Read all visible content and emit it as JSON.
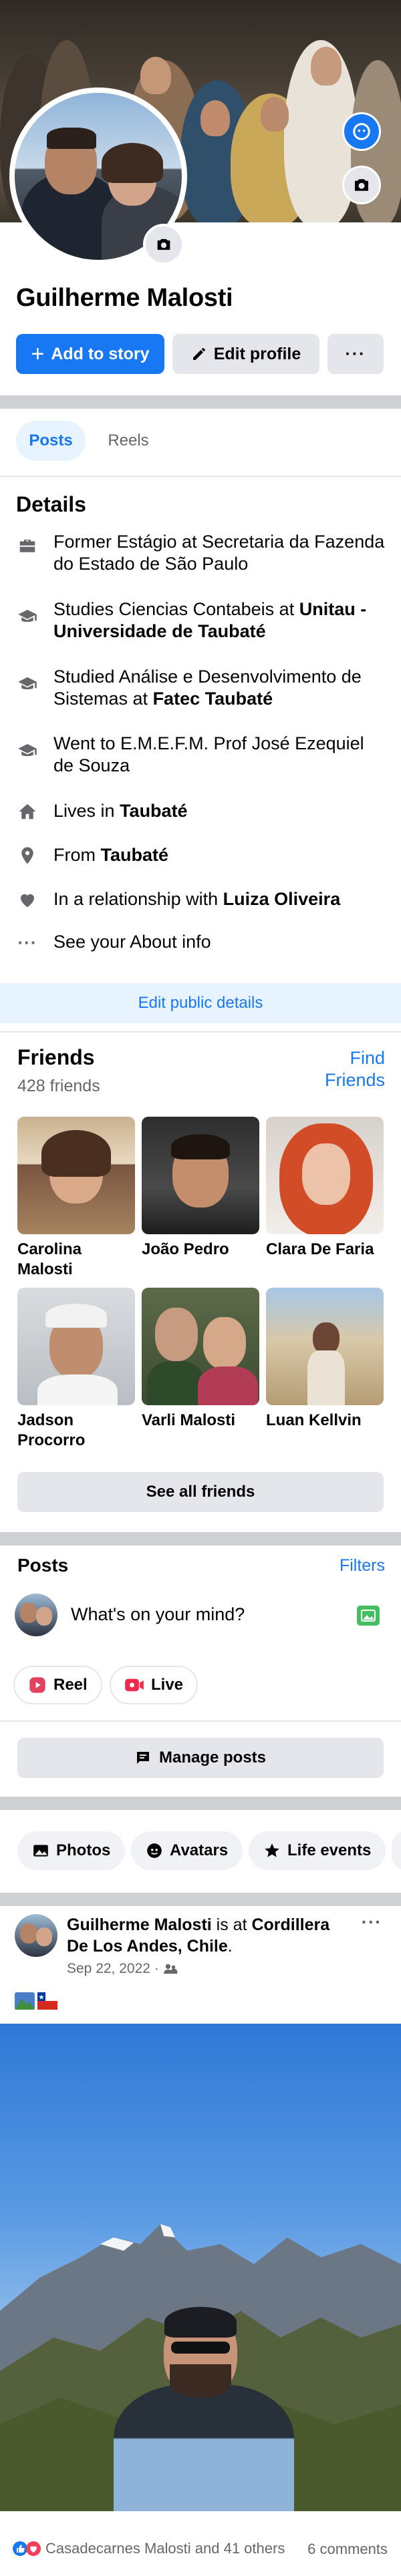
{
  "profile": {
    "name": "Guilherme Malosti",
    "add_to_story": "Add to story",
    "edit_profile": "Edit profile",
    "more": "···"
  },
  "tabs": [
    {
      "label": "Posts",
      "active": true
    },
    {
      "label": "Reels",
      "active": false
    }
  ],
  "details": {
    "heading": "Details",
    "items": [
      {
        "icon": "briefcase-icon",
        "text": "Former Estágio at Secretaria da Fazenda do Estado de São Paulo",
        "bold": ""
      },
      {
        "icon": "graduation-cap-icon",
        "text": "Studies Ciencias Contabeis at ",
        "bold": "Unitau - Universidade de Taubaté"
      },
      {
        "icon": "graduation-cap-icon",
        "text": "Studied Análise e Desenvolvimento de Sistemas at ",
        "bold": "Fatec Taubaté"
      },
      {
        "icon": "graduation-cap-icon",
        "text": "Went to E.M.E.F.M. Prof José Ezequiel de Souza",
        "bold": ""
      },
      {
        "icon": "home-icon",
        "text": "Lives in ",
        "bold": "Taubaté"
      },
      {
        "icon": "location-pin-icon",
        "text": "From ",
        "bold": "Taubaté"
      },
      {
        "icon": "heart-icon",
        "text": "In a relationship with ",
        "bold": "Luiza Oliveira"
      },
      {
        "icon": "more-dots-icon",
        "text": "See your About info",
        "bold": ""
      }
    ],
    "edit_button": "Edit public details"
  },
  "friends": {
    "heading": "Friends",
    "count": "428 friends",
    "find": "Find Friends",
    "list": [
      {
        "name": "Carolina Malosti"
      },
      {
        "name": "João Pedro"
      },
      {
        "name": "Clara De Faria"
      },
      {
        "name": "Jadson Procorro"
      },
      {
        "name": "Varli Malosti"
      },
      {
        "name": "Luan Kellvin"
      }
    ],
    "see_all": "See all friends"
  },
  "posts_section": {
    "heading": "Posts",
    "filters": "Filters",
    "composer_placeholder": "What's on your mind?",
    "reel": "Reel",
    "live": "Live",
    "manage": "Manage posts"
  },
  "chips": [
    "Photos",
    "Avatars",
    "Life events"
  ],
  "post": {
    "author": "Guilherme Malosti",
    "is_at": " is at ",
    "place": "Cordillera De Los Andes, Chile",
    "date": "Sep 22, 2022 ·",
    "reactions": "Casadecarnes Malosti and 41 others",
    "comments": "6 comments",
    "more": "···"
  },
  "colors": {
    "accent": "#1877f2",
    "separator": "#ced0d4",
    "secondary_text": "#65676b",
    "button_grey": "#e4e6eb"
  }
}
